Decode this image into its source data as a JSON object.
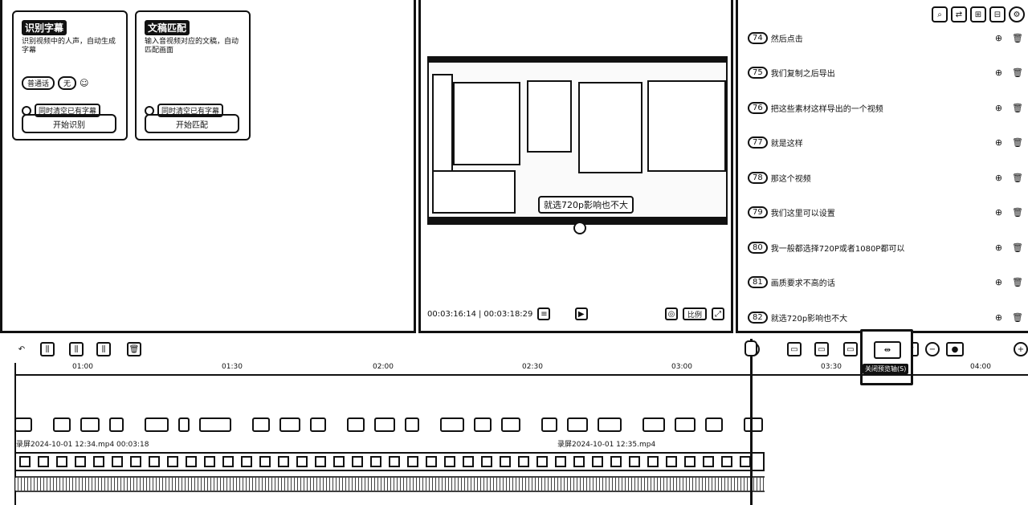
{
  "left_panel": {
    "card_recognize": {
      "title": "识别字幕",
      "description": "识别视频中的人声，自动生成字幕",
      "lang_tag": "普通话",
      "extra_tag": "无",
      "clear_label": "同时清空已有字幕",
      "button_label": "开始识别"
    },
    "card_text": {
      "title": "文稿匹配",
      "description": "输入音视频对应的文稿，自动匹配画面",
      "clear_label": "同时清空已有字幕",
      "button_label": "开始匹配"
    }
  },
  "player": {
    "caption": "就选720p影响也不大",
    "current_time": "00:03:16:14",
    "total_time": "00:03:18:29",
    "ratio_label": "比例"
  },
  "subtitles": [
    {
      "num": "74",
      "text": "然后点击"
    },
    {
      "num": "75",
      "text": "我们复制之后导出"
    },
    {
      "num": "76",
      "text": "把这些素材这样导出的一个视频"
    },
    {
      "num": "77",
      "text": "就是这样"
    },
    {
      "num": "78",
      "text": "那这个视频"
    },
    {
      "num": "79",
      "text": "我们这里可以设置"
    },
    {
      "num": "80",
      "text": "我一般都选择720P或者1080P都可以"
    },
    {
      "num": "81",
      "text": "画质要求不高的话"
    },
    {
      "num": "82",
      "text": "就选720p影响也不大"
    }
  ],
  "timeline": {
    "ticks": [
      "01:00",
      "01:30",
      "02:00",
      "02:30",
      "03:00",
      "03:30",
      "04:00"
    ],
    "file_label_1": "录屏2024-10-01 12:34.mp4  00:03:18",
    "file_label_2": "录屏2024-10-01 12:35.mp4",
    "tooltip": "关闭预览轴(S)"
  }
}
